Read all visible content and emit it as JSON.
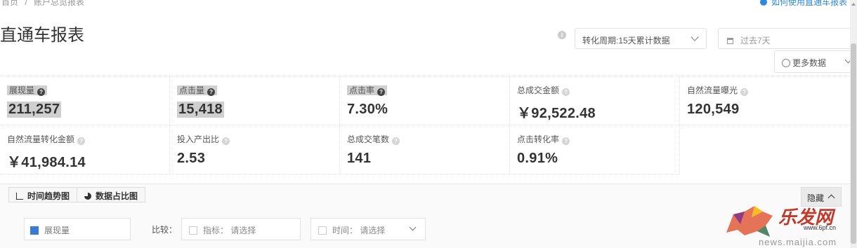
{
  "breadcrumb": [
    "首页",
    "账户总览报表"
  ],
  "help_link": "如何使用直通车报表",
  "page_title": "直通车报表",
  "info_icon_glyph": "i",
  "conversion_period": "转化周期:15天累计数据",
  "date_range": "过去7天",
  "more_data": "更多数据",
  "help_glyph": "?",
  "metrics": [
    {
      "label": "展现量",
      "value": "211,257"
    },
    {
      "label": "点击量",
      "value": "15,418"
    },
    {
      "label": "点击率",
      "value": "7.30%"
    },
    {
      "label": "总成交金额",
      "value": "￥92,522.48"
    },
    {
      "label": "自然流量曝光",
      "value": "120,549"
    },
    {
      "label": "自然流量转化金额",
      "value": "￥41,984.14"
    },
    {
      "label": "投入产出比",
      "value": "2.53"
    },
    {
      "label": "总成交笔数",
      "value": "141"
    },
    {
      "label": "点击转化率",
      "value": "0.91%"
    }
  ],
  "tabs": [
    "时间趋势图",
    "数据占比图"
  ],
  "hide_button": "隐藏",
  "metric_selector": "展现量",
  "compare_label": "比较：",
  "index_picker": "指标： 请选择",
  "time_picker": "时间： 请选择",
  "watermark": {
    "brand": "乐发网",
    "url": "www.6pf.cn",
    "url2": "news.maijia.com"
  },
  "colors": {
    "accent": "#3089dc",
    "series": "#3a7bd5",
    "watermark": "#c0392b"
  }
}
